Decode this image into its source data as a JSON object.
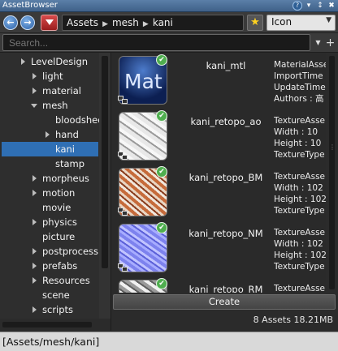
{
  "window": {
    "title": "AssetBrowser",
    "buttons": {
      "help": "?",
      "menu": "▾",
      "pin": "✖",
      "close": "✖"
    }
  },
  "toolbar": {
    "back_icon": "←",
    "forward_icon": "→",
    "path_segments": [
      "Assets",
      "mesh",
      "kani"
    ],
    "path_separator": "▶",
    "favorite_icon": "★",
    "view_mode": "Icon",
    "view_mode_arrow": "▼"
  },
  "search": {
    "placeholder": "Search...",
    "dropdown_icon": "▼",
    "add_icon": "+"
  },
  "tree": {
    "items": [
      {
        "label": "LevelDesign",
        "depth": 0,
        "expand": "collapsed"
      },
      {
        "label": "light",
        "depth": 0,
        "expand": "collapsed"
      },
      {
        "label": "material",
        "depth": 0,
        "expand": "collapsed"
      },
      {
        "label": "mesh",
        "depth": 0,
        "expand": "expanded"
      },
      {
        "label": "bloodshed",
        "depth": 1,
        "expand": "none"
      },
      {
        "label": "hand",
        "depth": 1,
        "expand": "collapsed"
      },
      {
        "label": "kani",
        "depth": 1,
        "expand": "none",
        "selected": true
      },
      {
        "label": "stamp",
        "depth": 1,
        "expand": "none"
      },
      {
        "label": "morpheus",
        "depth": 0,
        "expand": "collapsed"
      },
      {
        "label": "motion",
        "depth": 0,
        "expand": "collapsed"
      },
      {
        "label": "movie",
        "depth": 0,
        "expand": "none"
      },
      {
        "label": "physics",
        "depth": 0,
        "expand": "collapsed"
      },
      {
        "label": "picture",
        "depth": 0,
        "expand": "none"
      },
      {
        "label": "postprocess",
        "depth": 0,
        "expand": "collapsed"
      },
      {
        "label": "prefabs",
        "depth": 0,
        "expand": "collapsed"
      },
      {
        "label": "Resources",
        "depth": 0,
        "expand": "collapsed"
      },
      {
        "label": "scene",
        "depth": 0,
        "expand": "none"
      },
      {
        "label": "scripts",
        "depth": 0,
        "expand": "collapsed"
      }
    ]
  },
  "assets": [
    {
      "name": "kani_mtl",
      "thumb": "material",
      "thumb_text": "Mat",
      "props": [
        "MaterialAsse",
        "ImportTime",
        "UpdateTime",
        "Authors : 高"
      ]
    },
    {
      "name": "kani_retopo_ao",
      "thumb": "ao",
      "props": [
        "TextureAsse",
        "Width : 10",
        "Height : 10",
        "TextureType"
      ]
    },
    {
      "name": "kani_retopo_BM",
      "thumb": "bm",
      "props": [
        "TextureAsse",
        "Width : 102",
        "Height : 102",
        "TextureType"
      ]
    },
    {
      "name": "kani_retopo_NM",
      "thumb": "nm",
      "props": [
        "TextureAsse",
        "Width : 102",
        "Height : 102",
        "TextureType"
      ]
    },
    {
      "name": "kani_retopo_RM",
      "thumb": "rm",
      "props": [
        "TextureAsse"
      ]
    }
  ],
  "actions": {
    "create_label": "Create"
  },
  "status": {
    "summary": "8 Assets 18.21MB",
    "current_path": "[Assets/mesh/kani]"
  },
  "colors": {
    "selection": "#2f6fb4",
    "title_bar": "#4a6f99",
    "status_ok": "#4fae4f",
    "favorite": "#ffd21f"
  }
}
